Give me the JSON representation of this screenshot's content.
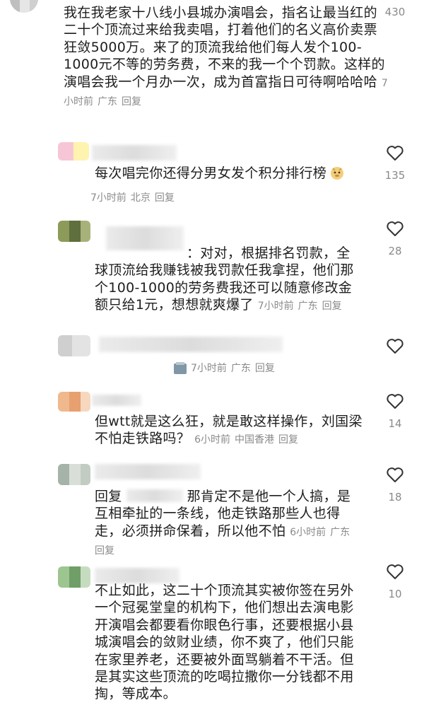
{
  "comments": [
    {
      "text": "我在我老家十八线小县城办演唱会，指名让最当红的二十个顶流过来给我卖唱，打着他们的名义高价卖票狂敛5000万。来了的顶流我给他们每人发个100-1000元不等的劳务费，不来的我一个个罚款。这样的演唱会我一个月办一次，成为首富指日可待啊哈哈哈",
      "time": "7小时前",
      "location": "广东",
      "reply": "回复",
      "likes": "430"
    },
    {
      "text": "每次唱完你还得分男女发个积分排行榜",
      "emoji": "emoji-doge",
      "time": "7小时前",
      "location": "北京",
      "reply": "回复",
      "likes": "135"
    },
    {
      "text": "：对对，根据排名罚款，全球顶流给我赚钱被我罚款任我拿捏，他们那个100-1000的劳务费我还可以随意修改金额只给1元，想想就爽爆了",
      "time": "7小时前",
      "location": "广东",
      "reply": "回复",
      "likes": "28"
    },
    {
      "text": "",
      "time": "7小时前",
      "location": "广东",
      "reply": "回复",
      "likes": ""
    },
    {
      "text": "但wtt就是这么狂，就是敢这样操作，刘国梁不怕走铁路吗？",
      "time": "6小时前",
      "location": "中国香港",
      "reply": "回复",
      "likes": "14"
    },
    {
      "text_prefix": "回复",
      "text": "那肯定不是他一个人搞，是互相牵扯的一条线，他走铁路那些人也得走，必须拼命保着，所以他不怕",
      "time": "6小时前",
      "location": "广东",
      "reply": "回复",
      "likes": "18"
    },
    {
      "text": "不止如此，这二十个顶流其实被你签在另外一个冠冕堂皇的机构下，他们想出去演电影开演唱会都要看你眼色行事，还要根据小县城演唱会的敛财业绩，你不爽了，他们只能在家里养老，还要被外面骂躺着不干活。但是其实这些顶流的吃喝拉撒你一分钱都不用掏，",
      "tail": "等成本。",
      "likes": "10"
    }
  ],
  "icons": {
    "like": "heart-outline-icon"
  },
  "colors": {
    "meta": "#8a8a8a",
    "text": "#1e1e1e"
  }
}
